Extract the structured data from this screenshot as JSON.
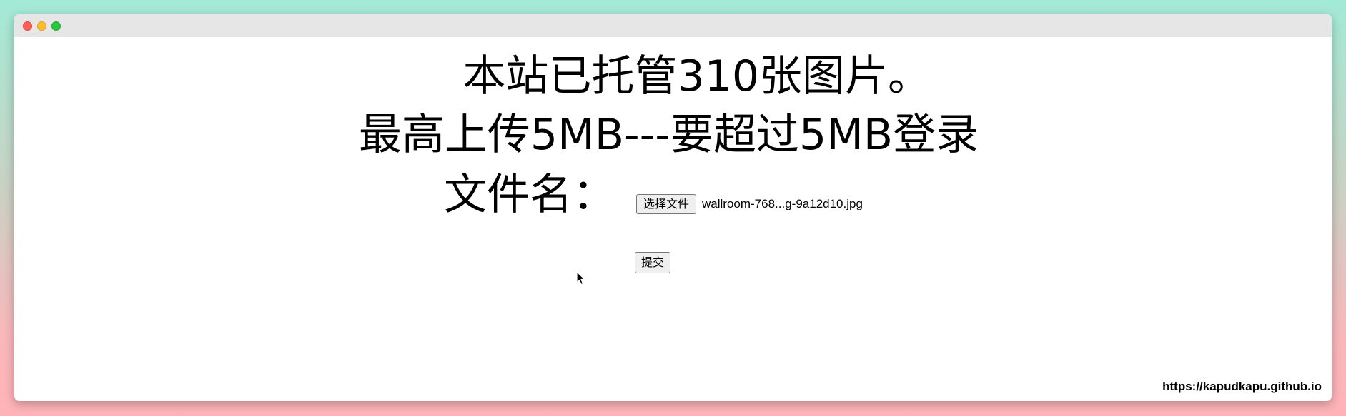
{
  "window": {
    "traffic_lights": [
      "close",
      "minimize",
      "zoom"
    ]
  },
  "page": {
    "hosted_notice": "本站已托管310张图片。",
    "upload_limit_notice": "最高上传5MB---要超过5MB登录",
    "file_label": "文件名：",
    "choose_file_button": "选择文件",
    "selected_file_name": "wallroom-768...g-9a12d10.jpg",
    "submit_button": "提交"
  },
  "watermark": "https://kapudkapu.github.io",
  "icons": {
    "cursor": "mouse-pointer-icon"
  },
  "colors": {
    "background_top": "#a3ead6",
    "background_bottom": "#ffb3b8",
    "titlebar": "#e6e6e6",
    "close": "#ff5f57",
    "minimize": "#febc2e",
    "zoom": "#28c840"
  }
}
